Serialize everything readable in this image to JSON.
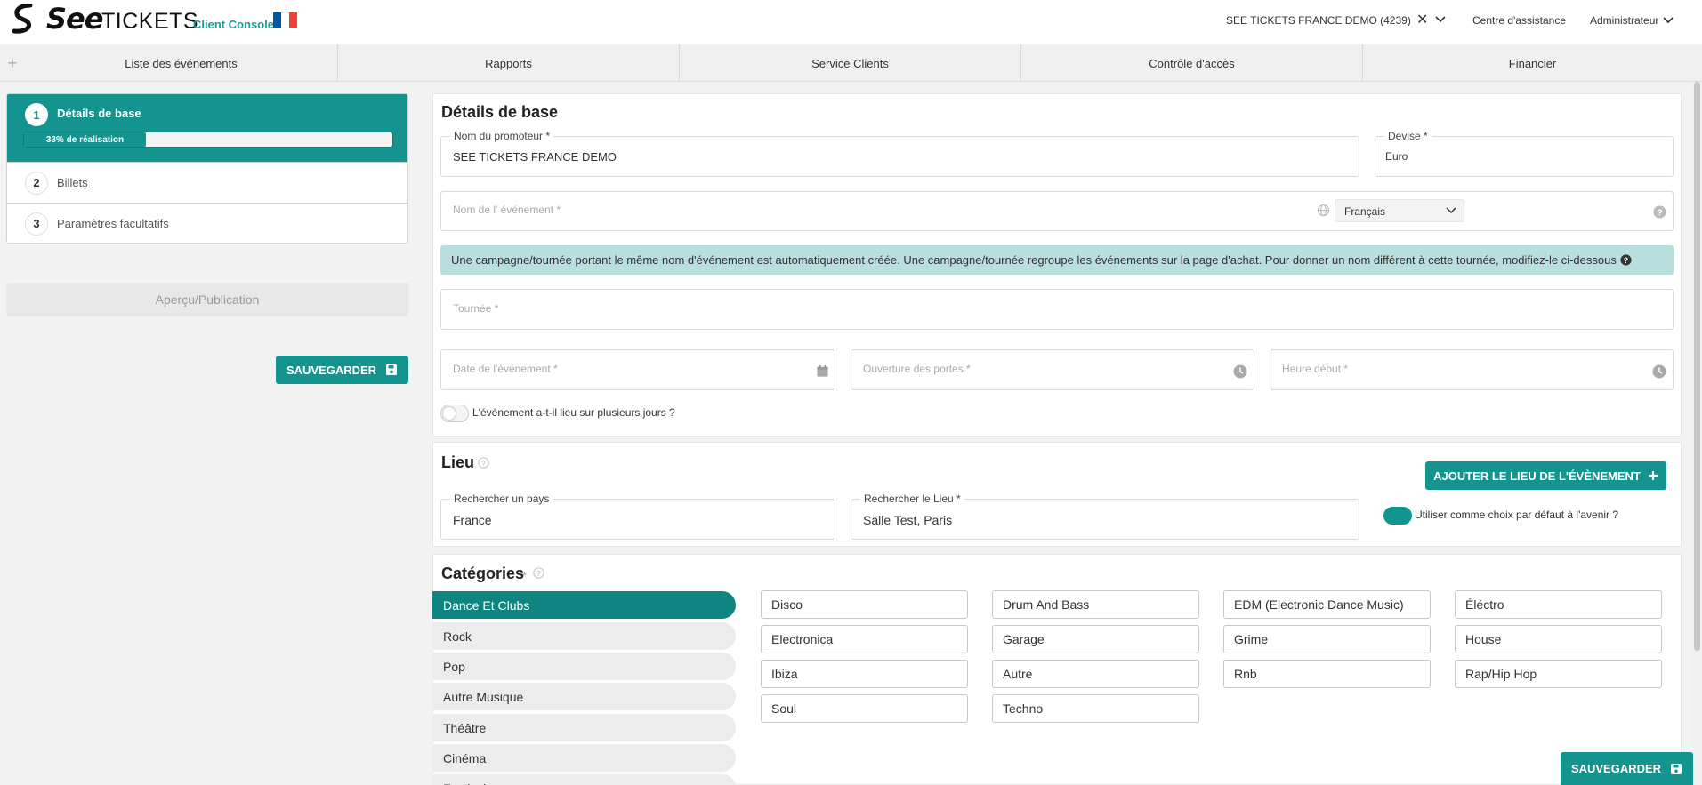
{
  "header": {
    "logo_see": "See",
    "logo_tickets": "TICKETS",
    "logo_console": "Client Console",
    "account_name": "SEE TICKETS FRANCE DEMO (4239)",
    "account_clear": "✕",
    "help_label": "Centre d'assistance",
    "admin_label": "Administrateur",
    "flag_colors": [
      "#0055a4",
      "#ffffff",
      "#ef4135"
    ]
  },
  "nav": {
    "plus": "+",
    "tabs": [
      "Liste des événements",
      "Rapports",
      "Service Clients",
      "Contrôle d'accès",
      "Financier"
    ]
  },
  "stepper": {
    "steps": [
      {
        "num": "1",
        "label": "Détails de base"
      },
      {
        "num": "2",
        "label": "Billets"
      },
      {
        "num": "3",
        "label": "Paramètres facultatifs"
      }
    ],
    "progress_text": "33% de réalisation",
    "progress_value": 0.33
  },
  "sidebar": {
    "preview_label": "Aperçu/Publication",
    "save_label": "SAUVEGARDER"
  },
  "basic": {
    "title": "Détails de base",
    "promoter_label": "Nom du promoteur *",
    "promoter_value": "SEE TICKETS FRANCE DEMO",
    "currency_label": "Devise *",
    "currency_value": "Euro",
    "event_name_placeholder": "Nom de l' événement *",
    "language_value": "Français",
    "info_text": "Une campagne/tournée portant le même nom d'événement est automatiquement créée. Une campagne/tournée regroupe les événements sur la page d'achat. Pour donner un nom différent à cette tournée, modifiez-le ci-dessous",
    "tour_placeholder": "Tournée *",
    "date_placeholder": "Date de l'événement *",
    "doors_placeholder": "Ouverture des portes *",
    "start_placeholder": "Heure début *",
    "multiday_label": "L'événement a-t-il lieu sur plusieurs jours ?"
  },
  "venue": {
    "title": "Lieu",
    "add_button": "AJOUTER LE LIEU DE L'ÉVÈNEMENT",
    "country_label": "Rechercher un pays",
    "country_value": "France",
    "venue_label": "Rechercher le Lieu *",
    "venue_value": "Salle Test, Paris",
    "default_label": "Utiliser comme choix par défaut à l'avenir ?"
  },
  "categories": {
    "title": "Catégories",
    "required": "*",
    "items": [
      "Dance Et Clubs",
      "Rock",
      "Pop",
      "Autre Musique",
      "Théâtre",
      "Cinéma",
      "Festivals"
    ],
    "sub_items": [
      "Disco",
      "Drum And Bass",
      "EDM (Electronic Dance Music)",
      "Éléctro",
      "Electronica",
      "Garage",
      "Grime",
      "House",
      "Ibiza",
      "Autre",
      "Rnb",
      "Rap/Hip Hop",
      "Soul",
      "Techno"
    ]
  },
  "footer": {
    "save_label": "SAUVEGARDER"
  }
}
